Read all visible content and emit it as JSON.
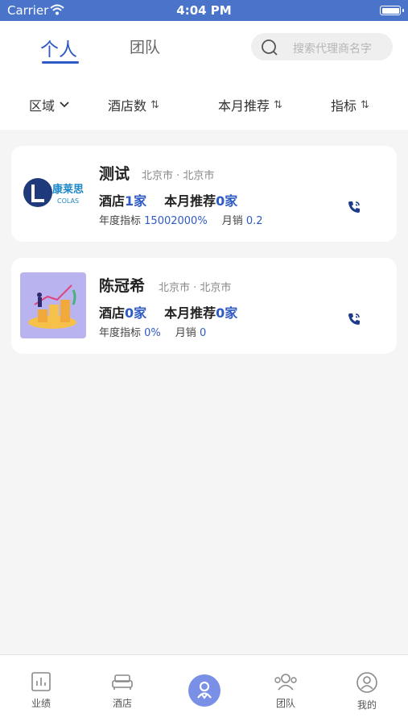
{
  "status_bar": {
    "carrier": "Carrier",
    "time": "4:04 PM"
  },
  "tabs": {
    "personal": "个人",
    "team": "团队"
  },
  "search": {
    "placeholder": "搜索代理商名字"
  },
  "filters": {
    "region": "区域",
    "hotels": "酒店数",
    "monthly": "本月推荐",
    "target": "指标",
    "sort_glyph": "⇅"
  },
  "cards": [
    {
      "name": "测试",
      "location": "北京市 · 北京市",
      "logo_text": "康莱思",
      "logo_subtext": "COLAS",
      "hotels_label": "酒店",
      "hotels_value": "1家",
      "monthly_label": "本月推荐",
      "monthly_value": "0家",
      "annual_label": "年度指标",
      "annual_value": "15002000%",
      "sales_label": "月销",
      "sales_value": "0.2"
    },
    {
      "name": "陈冠希",
      "location": "北京市 · 北京市",
      "hotels_label": "酒店",
      "hotels_value": "0家",
      "monthly_label": "本月推荐",
      "monthly_value": "0家",
      "annual_label": "年度指标",
      "annual_value": "0%",
      "sales_label": "月销",
      "sales_value": "0"
    }
  ],
  "tabbar": {
    "performance": "业绩",
    "hotel": "酒店",
    "team": "团队",
    "mine": "我的"
  },
  "colors": {
    "accent": "#2f5ac6",
    "status_bar": "#4a74c9",
    "background": "#f5f5f6"
  }
}
